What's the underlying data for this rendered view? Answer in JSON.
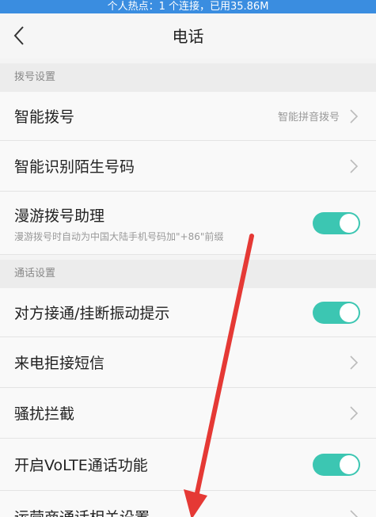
{
  "status": {
    "hotspot_text": "个人热点：1 个连接，已用35.86M"
  },
  "header": {
    "title": "电话",
    "back_icon": "chevron-left-icon"
  },
  "sections": [
    {
      "title": "拨号设置",
      "items": [
        {
          "label": "智能拨号",
          "value": "智能拼音拨号",
          "control": "chevron"
        },
        {
          "label": "智能识别陌生号码",
          "control": "chevron"
        },
        {
          "label": "漫游拨号助理",
          "subtitle": "漫游拨号时自动为中国大陆手机号码加\"+86\"前缀",
          "control": "toggle",
          "enabled": true
        }
      ]
    },
    {
      "title": "通话设置",
      "items": [
        {
          "label": "对方接通/挂断振动提示",
          "control": "toggle",
          "enabled": true
        },
        {
          "label": "来电拒接短信",
          "control": "chevron"
        },
        {
          "label": "骚扰拦截",
          "control": "chevron"
        },
        {
          "label": "开启VoLTE通话功能",
          "control": "toggle",
          "enabled": true
        },
        {
          "label": "运营商通话相关设置",
          "control": "chevron"
        }
      ]
    }
  ],
  "colors": {
    "toggle_on": "#3cc6b2",
    "status_bar": "#3a8de0",
    "annotation_arrow": "#e53935"
  }
}
